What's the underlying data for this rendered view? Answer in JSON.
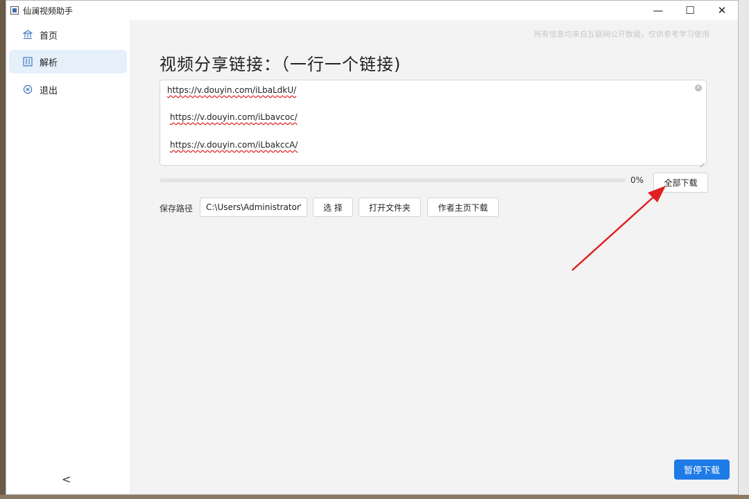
{
  "window": {
    "title": "仙澜视频助手",
    "controls": {
      "minimize": "—",
      "maximize": "☐",
      "close": "✕"
    }
  },
  "sidebar": {
    "items": [
      {
        "label": "首页",
        "icon": "bank-icon",
        "active": false
      },
      {
        "label": "解析",
        "icon": "grid-icon",
        "active": true
      },
      {
        "label": "退出",
        "icon": "close-circle-icon",
        "active": false
      }
    ],
    "collapse": "<"
  },
  "main": {
    "disclaimer": "所有信息均来自互联网公开数据，仅供参考学习使用",
    "title": "视频分享链接：（一行一个链接)",
    "links": [
      "https://v.douyin.com/iLbaLdkU/",
      "https://v.douyin.com/iLbavcoc/",
      "https://v.douyin.com/iLbakccA/"
    ],
    "progress": {
      "value": 0,
      "label": "0%"
    },
    "buttons": {
      "download_all": "全部下载",
      "choose": "选 择",
      "open_folder": "打开文件夹",
      "author_home": "作者主页下载",
      "pause": "暂停下载"
    },
    "save_path": {
      "label": "保存路径",
      "value": "C:\\Users\\Administrator\\I"
    }
  },
  "colors": {
    "accent": "#1e7ae6",
    "active_bg": "#e6f0fb",
    "annotation": "#e02020"
  }
}
